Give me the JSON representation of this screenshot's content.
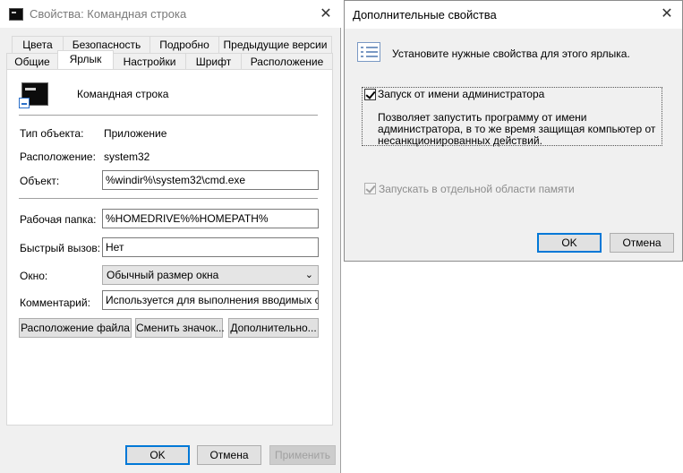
{
  "main_window": {
    "title": "Свойства: Командная строка",
    "tabs_row1": [
      "Цвета",
      "Безопасность",
      "Подробно",
      "Предыдущие версии"
    ],
    "tabs_row2": [
      "Общие",
      "Ярлык",
      "Настройки",
      "Шрифт",
      "Расположение"
    ],
    "active_tab": "Ярлык",
    "shortcut_name": "Командная строка",
    "labels": {
      "type": "Тип объекта:",
      "location": "Расположение:",
      "target": "Объект:",
      "start_in": "Рабочая папка:",
      "hotkey": "Быстрый вызов:",
      "run": "Окно:",
      "comment": "Комментарий:"
    },
    "values": {
      "type": "Приложение",
      "location": "system32",
      "target": "%windir%\\system32\\cmd.exe",
      "start_in": "%HOMEDRIVE%%HOMEPATH%",
      "hotkey": "Нет",
      "run": "Обычный размер окна",
      "comment": "Используется для выполнения вводимых с кла"
    },
    "buttons": {
      "open_location": "Расположение файла",
      "change_icon": "Сменить значок...",
      "advanced": "Дополнительно...",
      "ok": "OK",
      "cancel": "Отмена",
      "apply": "Применить"
    }
  },
  "advanced_dialog": {
    "title": "Дополнительные свойства",
    "header": "Установите нужные свойства для этого ярлыка.",
    "run_as_admin": {
      "label": "Запуск от имени администратора",
      "checked": true,
      "description": "Позволяет запустить программу от имени администратора, в то же время защищая компьютер от несанкционированных действий."
    },
    "separate_memory": {
      "label": "Запускать в отдельной области памяти",
      "checked": true,
      "enabled": false
    },
    "buttons": {
      "ok": "OK",
      "cancel": "Отмена"
    }
  }
}
